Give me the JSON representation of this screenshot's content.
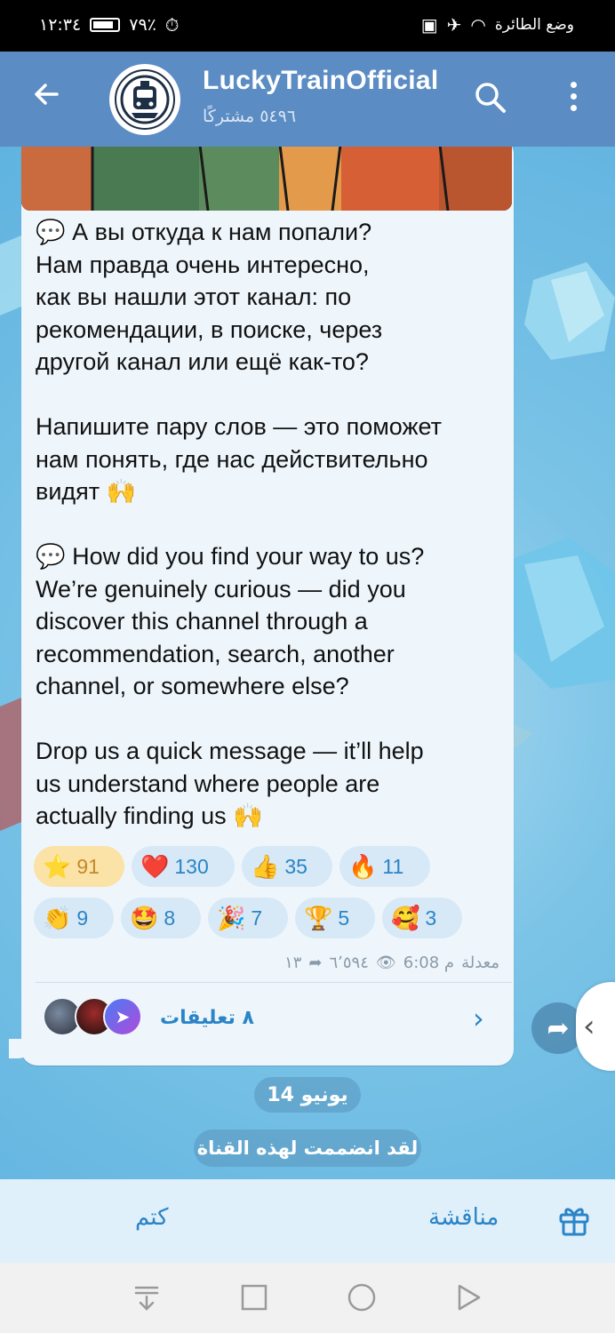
{
  "status_bar": {
    "time": "١٢:٣٤",
    "battery": "٧٩٪",
    "mode": "وضع الطائرة"
  },
  "header": {
    "title": "LuckyTrainOfficial",
    "subtitle": "٥٤٩٦ مشتركًا"
  },
  "message": {
    "text": "💬 А вы откуда к нам попали?\nНам правда очень интересно,\nкак вы нашли этот канал: по\nрекомендации, в поиске, через\nдругой канал или ещё как-то?\n\nНапишите пару слов — это поможет\nнам понять, где нас действительно\nвидят 🙌\n\n💬 How did you find your way to us?\nWe’re genuinely curious — did you\ndiscover this channel through a\nrecommendation, search, another\nchannel, or somewhere else?\n\nDrop us a quick message — it’ll help\nus understand where people are\nactually finding us 🙌",
    "reactions": [
      {
        "emoji": "⭐",
        "count": "91"
      },
      {
        "emoji": "❤️",
        "count": "130"
      },
      {
        "emoji": "👍",
        "count": "35"
      },
      {
        "emoji": "🔥",
        "count": "11"
      },
      {
        "emoji": "👏",
        "count": "9"
      },
      {
        "emoji": "🤩",
        "count": "8"
      },
      {
        "emoji": "🎉",
        "count": "7"
      },
      {
        "emoji": "🏆",
        "count": "5"
      },
      {
        "emoji": "🥰",
        "count": "3"
      }
    ],
    "edited": "معدلة",
    "time": "6:08 م",
    "views": "٦٬٥٩٤",
    "shares": "١٣",
    "comments_label": "٨ تعليقات"
  },
  "service": {
    "date": "14 يونيو",
    "joined": "لقد انضممت لهذه القناة"
  },
  "bottom_bar": {
    "mute": "كتم",
    "discussion": "مناقشة"
  },
  "colors": {
    "header": "#5b8cc3",
    "accent": "#2a84c7",
    "bubble": "#eef6fc"
  }
}
